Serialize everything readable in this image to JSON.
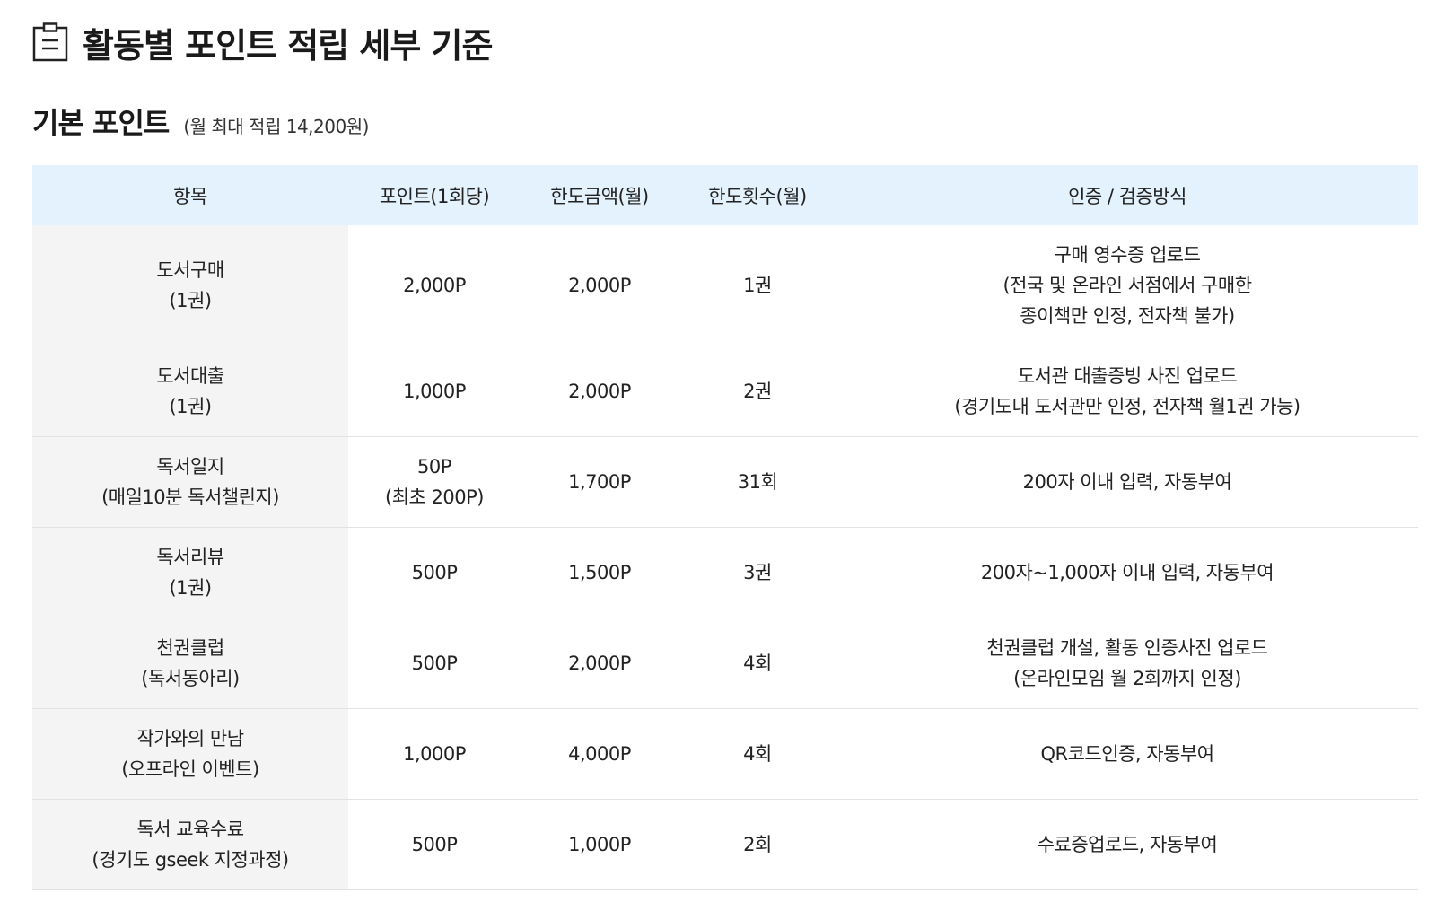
{
  "header": {
    "icon": "clipboard-icon",
    "title": "활동별 포인트 적립 세부 기준"
  },
  "section": {
    "title": "기본 포인트",
    "note": "(월 최대 적립 14,200원)"
  },
  "table": {
    "columns": [
      "항목",
      "포인트(1회당)",
      "한도금액(월)",
      "한도횟수(월)",
      "인증 / 검증방식"
    ],
    "rows": [
      {
        "item": [
          "도서구매",
          "(1권)"
        ],
        "points": [
          "2,000P"
        ],
        "limit_amount": "2,000P",
        "limit_count": "1권",
        "verification": [
          "구매 영수증 업로드",
          "(전국 및 온라인 서점에서 구매한",
          "종이책만 인정, 전자책 불가)"
        ]
      },
      {
        "item": [
          "도서대출",
          "(1권)"
        ],
        "points": [
          "1,000P"
        ],
        "limit_amount": "2,000P",
        "limit_count": "2권",
        "verification": [
          "도서관 대출증빙 사진 업로드",
          "(경기도내 도서관만 인정, 전자책 월1권 가능)"
        ]
      },
      {
        "item": [
          "독서일지",
          "(매일10분 독서챌린지)"
        ],
        "points": [
          "50P",
          "(최초 200P)"
        ],
        "limit_amount": "1,700P",
        "limit_count": "31회",
        "verification": [
          "200자 이내 입력, 자동부여"
        ]
      },
      {
        "item": [
          "독서리뷰",
          "(1권)"
        ],
        "points": [
          "500P"
        ],
        "limit_amount": "1,500P",
        "limit_count": "3권",
        "verification": [
          "200자~1,000자 이내 입력, 자동부여"
        ]
      },
      {
        "item": [
          "천권클럽",
          "(독서동아리)"
        ],
        "points": [
          "500P"
        ],
        "limit_amount": "2,000P",
        "limit_count": "4회",
        "verification": [
          "천권클럽 개설, 활동 인증사진 업로드",
          "(온라인모임 월 2회까지 인정)"
        ]
      },
      {
        "item": [
          "작가와의 만남",
          "(오프라인 이벤트)"
        ],
        "points": [
          "1,000P"
        ],
        "limit_amount": "4,000P",
        "limit_count": "4회",
        "verification": [
          "QR코드인증, 자동부여"
        ]
      },
      {
        "item": [
          "독서 교육수료",
          "(경기도 gseek 지정과정)"
        ],
        "points": [
          "500P"
        ],
        "limit_amount": "1,000P",
        "limit_count": "2회",
        "verification": [
          "수료증업로드, 자동부여"
        ]
      }
    ]
  }
}
